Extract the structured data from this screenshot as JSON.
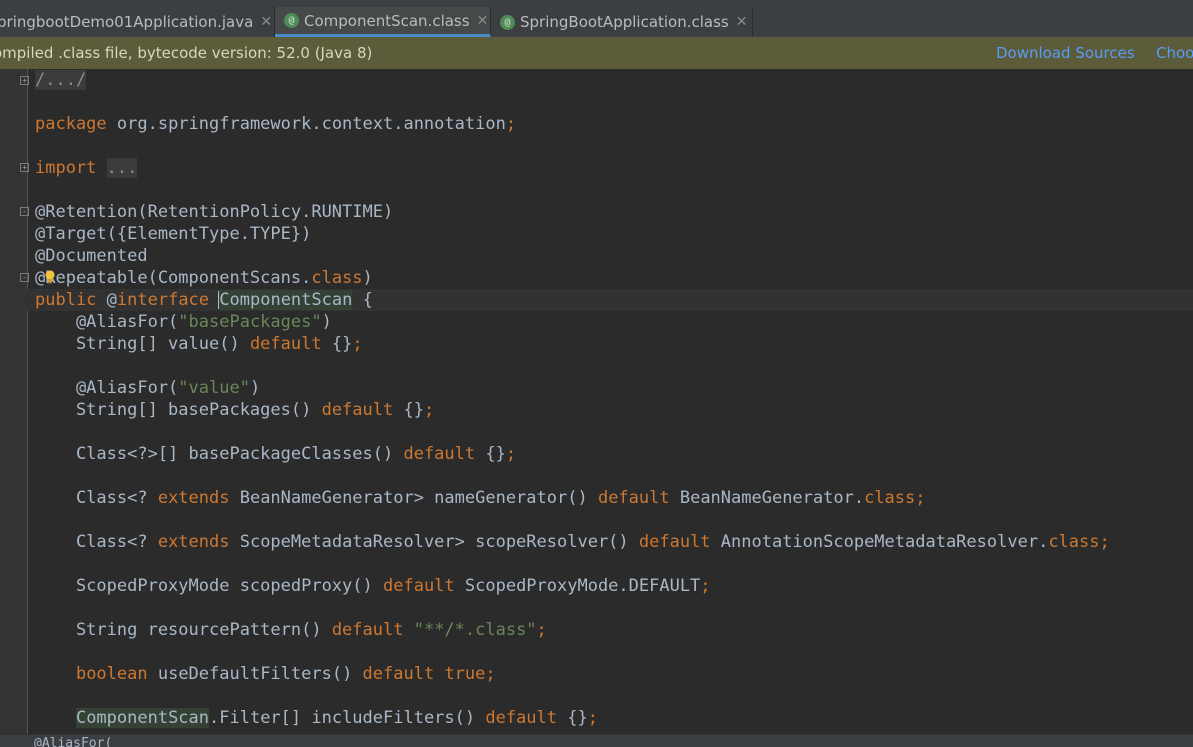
{
  "tabs": [
    {
      "label": "pringbootDemo01Application.java",
      "icon": "java-class-icon",
      "active": false
    },
    {
      "label": "ComponentScan.class",
      "icon": "annotation-icon",
      "active": true
    },
    {
      "label": "SpringBootApplication.class",
      "icon": "annotation-icon",
      "active": false
    }
  ],
  "tab_icon_glyph": "@",
  "close_glyph": "✕",
  "banner": {
    "text": "ompiled .class file, bytecode version: 52.0 (Java 8)",
    "download_sources": "Download Sources",
    "choose_sources": "Choo"
  },
  "code": {
    "l1": "/.../",
    "l3_kw": "package",
    "l3_rest": " org.springframework.context.annotation",
    "l3_semi": ";",
    "l5_kw": "import",
    "l5_fold": "...",
    "l7": "@Retention(RetentionPolicy.RUNTIME)",
    "l8": "@Target({ElementType.TYPE})",
    "l9": "@Documented",
    "l10_a": "@Repeatable(ComponentScans.",
    "l10_kw": "class",
    "l10_b": ")",
    "l11_kw1": "public",
    "l11_sp": " @",
    "l11_kw2": "interface",
    "l11_sp2": " ",
    "l11_name": "ComponentScan",
    "l11_brace": " {",
    "l12_a": "    @AliasFor(",
    "l12_str": "\"basePackages\"",
    "l12_b": ")",
    "l13_a": "    String[] value() ",
    "l13_kw": "default",
    "l13_b": " {}",
    "l13_semi": ";",
    "l15_a": "    @AliasFor(",
    "l15_str": "\"value\"",
    "l15_b": ")",
    "l16_a": "    String[] basePackages() ",
    "l16_kw": "default",
    "l16_b": " {}",
    "l16_semi": ";",
    "l18_a": "    Class<?>[] basePackageClasses() ",
    "l18_kw": "default",
    "l18_b": " {}",
    "l18_semi": ";",
    "l20_a": "    Class<? ",
    "l20_kw1": "extends",
    "l20_b": " BeanNameGenerator> nameGenerator() ",
    "l20_kw2": "default",
    "l20_c": " BeanNameGenerator.",
    "l20_kw3": "class;",
    "l22_a": "    Class<? ",
    "l22_kw1": "extends",
    "l22_b": " ScopeMetadataResolver> scopeResolver() ",
    "l22_kw2": "default",
    "l22_c": " AnnotationScopeMetadataResolver.",
    "l22_kw3": "class;",
    "l24_a": "    ScopedProxyMode scopedProxy() ",
    "l24_kw": "default",
    "l24_b": " ScopedProxyMode.DEFAULT",
    "l24_semi": ";",
    "l26_a": "    String resourcePattern() ",
    "l26_kw": "default",
    "l26_sp": " ",
    "l26_str": "\"**/*.class\"",
    "l26_semi": ";",
    "l28_kw1": "boolean",
    "l28_a": " useDefaultFilters() ",
    "l28_kw2": "default",
    "l28_kw3": " true;",
    "l30_hl": "ComponentScan",
    "l30_a": ".Filter[] includeFilters() ",
    "l30_kw": "default",
    "l30_b": " {}",
    "l30_semi": ";",
    "l_partial": "    @AliasFor("
  },
  "colors": {
    "keyword": "#cc7832",
    "string": "#6a8759",
    "annotation": "#bbb529",
    "text": "#a9b7c6",
    "link": "#589df6",
    "banner_bg": "#5c5b3a"
  }
}
